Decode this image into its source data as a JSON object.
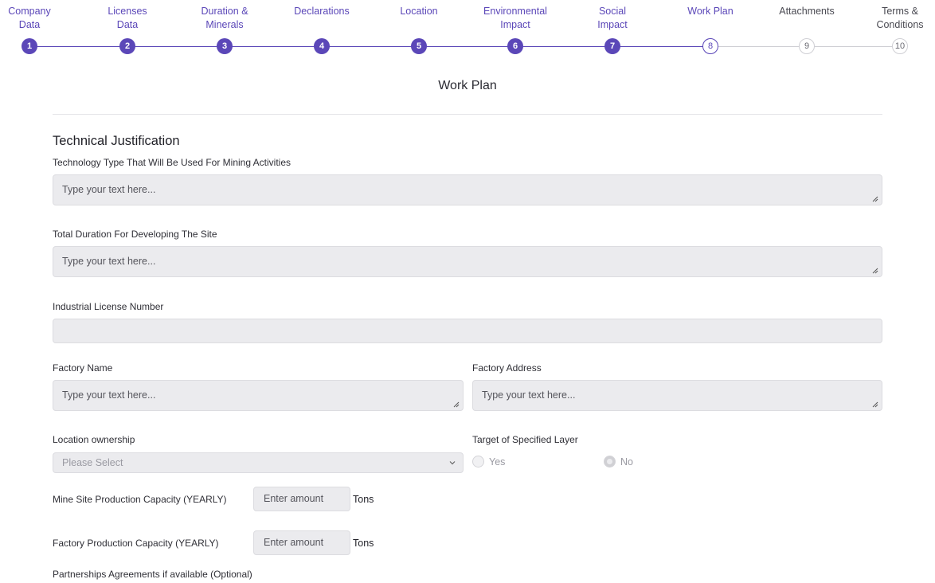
{
  "stepper": {
    "steps": [
      {
        "label": "Company\nData",
        "number": "1",
        "state": "done"
      },
      {
        "label": "Licenses\nData",
        "number": "2",
        "state": "done"
      },
      {
        "label": "Duration &\nMinerals",
        "number": "3",
        "state": "done"
      },
      {
        "label": "Declarations",
        "number": "4",
        "state": "done"
      },
      {
        "label": "Location",
        "number": "5",
        "state": "done"
      },
      {
        "label": "Environmental\nImpact",
        "number": "6",
        "state": "done"
      },
      {
        "label": "Social\nImpact",
        "number": "7",
        "state": "done"
      },
      {
        "label": "Work Plan",
        "number": "8",
        "state": "current"
      },
      {
        "label": "Attachments",
        "number": "9",
        "state": "pending"
      },
      {
        "label": "Terms &\nConditions",
        "number": "10",
        "state": "pending"
      }
    ],
    "colors": {
      "done": "#5b47b8",
      "pending": "#cfcfd4"
    }
  },
  "page_title": "Work Plan",
  "section_title": "Technical Justification",
  "fields": {
    "technology_type": {
      "label": "Technology Type That Will Be Used For Mining Activities",
      "placeholder": "Type your text here..."
    },
    "total_duration": {
      "label": "Total Duration For Developing The Site",
      "placeholder": "Type your text here..."
    },
    "industrial_license": {
      "label": "Industrial License Number",
      "value": ""
    },
    "factory_name": {
      "label": "Factory Name",
      "placeholder": "Type your text here..."
    },
    "factory_address": {
      "label": "Factory Address",
      "placeholder": "Type your text here..."
    },
    "location_ownership": {
      "label": "Location ownership",
      "selected": "Please Select"
    },
    "target_layer": {
      "label": "Target of Specified Layer",
      "options": [
        "Yes",
        "No"
      ],
      "checked": "No"
    },
    "mine_capacity": {
      "label": "Mine Site Production Capacity (YEARLY)",
      "placeholder": "Enter amount",
      "unit": "Tons"
    },
    "factory_capacity": {
      "label": "Factory Production Capacity (YEARLY)",
      "placeholder": "Enter amount",
      "unit": "Tons"
    },
    "partnerships": {
      "label": "Partnerships Agreements if available (Optional)"
    }
  },
  "icons": {
    "resize": "resize-handle-icon",
    "chevron": "chevron-down-icon"
  },
  "accent_color": "#5b47b8"
}
